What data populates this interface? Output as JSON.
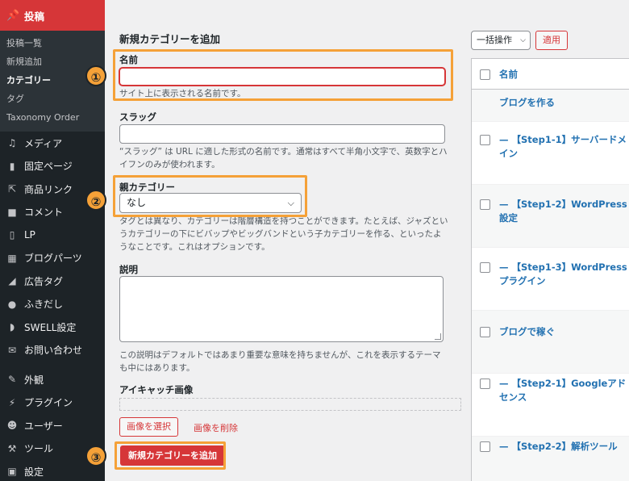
{
  "sidebar": {
    "current": {
      "label": "投稿",
      "icon": "pin-icon"
    },
    "submenu": [
      "投稿一覧",
      "新規追加",
      "カテゴリー",
      "タグ",
      "Taxonomy Order"
    ],
    "items": [
      {
        "label": "メディア",
        "icon": "media-icon"
      },
      {
        "label": "固定ページ",
        "icon": "page-icon"
      },
      {
        "label": "商品リンク",
        "icon": "external-link-icon"
      },
      {
        "label": "コメント",
        "icon": "comment-icon"
      },
      {
        "label": "LP",
        "icon": "document-icon"
      },
      {
        "label": "ブログパーツ",
        "icon": "blocks-icon"
      },
      {
        "label": "広告タグ",
        "icon": "megaphone-icon"
      },
      {
        "label": "ふきだし",
        "icon": "speech-bubble-icon"
      },
      {
        "label": "SWELL設定",
        "icon": "swell-icon"
      },
      {
        "label": "お問い合わせ",
        "icon": "mail-icon"
      },
      {
        "label": "外観",
        "icon": "brush-icon"
      },
      {
        "label": "プラグイン",
        "icon": "plugin-icon"
      },
      {
        "label": "ユーザー",
        "icon": "user-icon"
      },
      {
        "label": "ツール",
        "icon": "wrench-icon"
      },
      {
        "label": "設定",
        "icon": "settings-icon"
      }
    ]
  },
  "form": {
    "title": "新規カテゴリーを追加",
    "name_label": "名前",
    "name_value": "",
    "name_help": "サイト上に表示される名前です。",
    "slug_label": "スラッグ",
    "slug_value": "",
    "slug_help": "“スラッグ” は URL に適した形式の名前です。通常はすべて半角小文字で、英数字とハイフンのみが使われます。",
    "parent_label": "親カテゴリー",
    "parent_value": "なし",
    "parent_help": "タグとは異なり、カテゴリーは階層構造を持つことができます。たとえば、ジャズというカテゴリーの下にビバップやビッグバンドという子カテゴリーを作る、といったようなことです。これはオプションです。",
    "desc_label": "説明",
    "desc_value": "",
    "desc_help": "この説明はデフォルトではあまり重要な意味を持ちませんが、これを表示するテーマも中にはあります。",
    "image_label": "アイキャッチ画像",
    "select_image": "画像を選択",
    "remove_image": "画像を削除",
    "submit": "新規カテゴリーを追加"
  },
  "annotations": [
    "①",
    "②",
    "③"
  ],
  "list": {
    "bulk_action": "一括操作",
    "apply": "適用",
    "column_name": "名前",
    "rows": [
      "ブログを作る",
      "— 【Step1-1】サーバードメイン",
      "— 【Step1-2】WordPress設定",
      "— 【Step1-3】WordPressプラグイン",
      "ブログで稼ぐ",
      "— 【Step2-1】Googleアドセンス",
      "— 【Step2-2】解析ツール"
    ]
  },
  "colors": {
    "accent": "#d63638",
    "highlight": "#f5a138",
    "link": "#2271b1",
    "sidebar": "#1d2327"
  }
}
